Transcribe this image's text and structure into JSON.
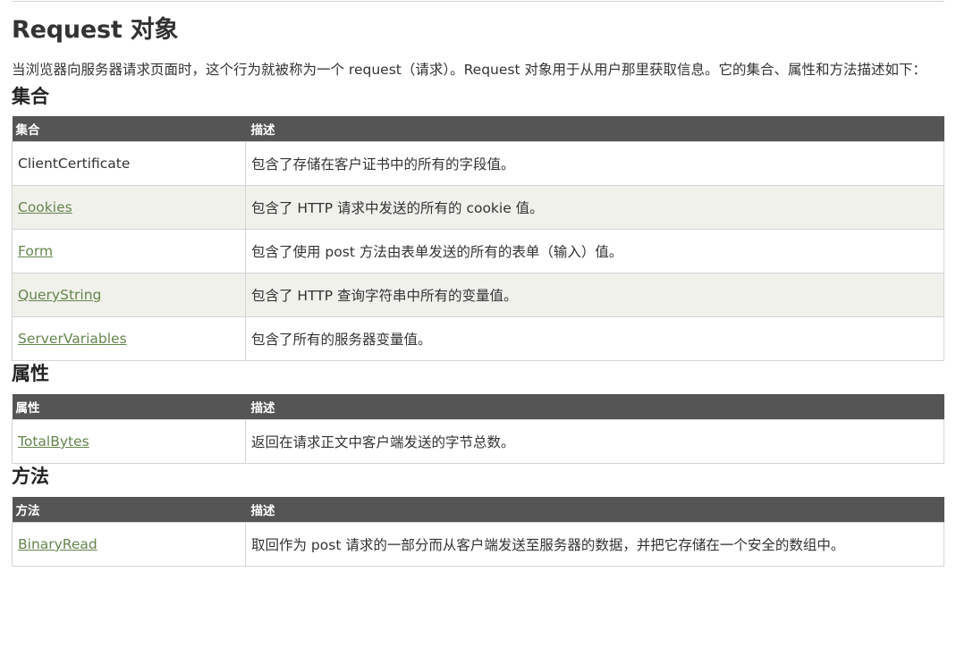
{
  "title": "Request 对象",
  "intro": "当浏览器向服务器请求页面时，这个行为就被称为一个 request（请求）。Request 对象用于从用户那里获取信息。它的集合、属性和方法描述如下：",
  "sections": [
    {
      "heading": "集合",
      "columns": [
        "集合",
        "描述"
      ],
      "rows": [
        {
          "name": "ClientCertificate",
          "description": "包含了存储在客户证书中的所有的字段值。"
        },
        {
          "name": "Cookies",
          "description": "包含了 HTTP 请求中发送的所有的 cookie 值。"
        },
        {
          "name": "Form",
          "description": "包含了使用 post 方法由表单发送的所有的表单（输入）值。"
        },
        {
          "name": "QueryString",
          "description": "包含了 HTTP 查询字符串中所有的变量值。"
        },
        {
          "name": "ServerVariables",
          "description": "包含了所有的服务器变量值。"
        }
      ]
    },
    {
      "heading": "属性",
      "columns": [
        "属性",
        "描述"
      ],
      "rows": [
        {
          "name": "TotalBytes",
          "description": "返回在请求正文中客户端发送的字节总数。"
        }
      ]
    },
    {
      "heading": "方法",
      "columns": [
        "方法",
        "描述"
      ],
      "rows": [
        {
          "name": "BinaryRead",
          "description": "取回作为 post 请求的一部分而从客户端发送至服务器的数据，并把它存储在一个安全的数组中。"
        }
      ]
    }
  ],
  "colors": {
    "header_bg": "#555555",
    "header_text": "#ffffff",
    "link": "#64854c",
    "alt_row_bg": "#f1f1ec",
    "border": "#d4d4d4"
  }
}
